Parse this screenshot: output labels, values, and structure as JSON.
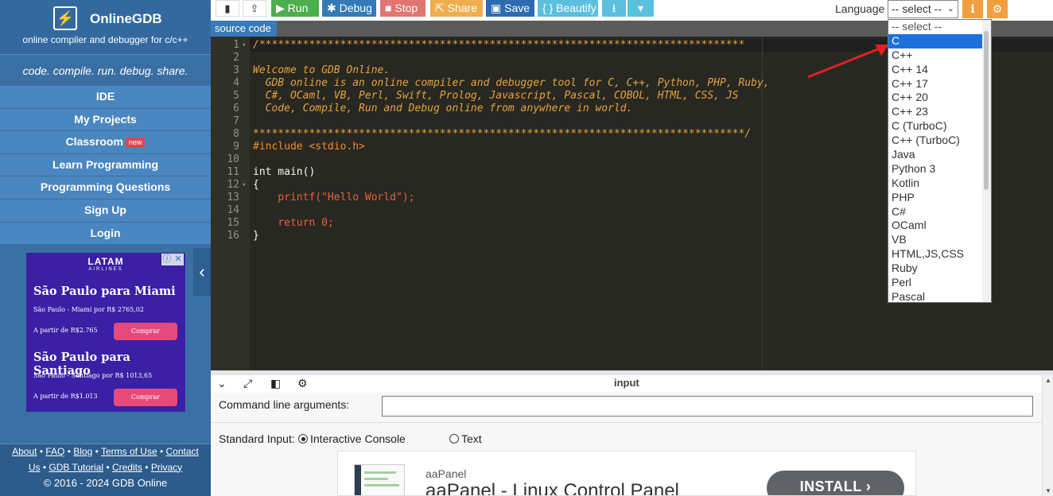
{
  "sidebar": {
    "brand_name": "OnlineGDB",
    "brand_subtitle": "online compiler and debugger for c/c++",
    "tagline": "code. compile. run. debug. share.",
    "nav": [
      "IDE",
      "My Projects",
      "Classroom",
      "Learn Programming",
      "Programming Questions",
      "Sign Up",
      "Login"
    ],
    "classroom_badge": "new",
    "footer": {
      "links_row1": [
        "About",
        "FAQ",
        "Blog",
        "Terms of Use",
        "Contact"
      ],
      "links_row2": [
        "Us",
        "GDB Tutorial",
        "Credits",
        "Privacy"
      ],
      "copyright": "© 2016 - 2024 GDB Online"
    }
  },
  "sidebar_ad": {
    "brand": "LATAM",
    "brand_sub": "AIRLINES",
    "offers": [
      {
        "headline": "São Paulo para Miami",
        "detail": "São Paulo - Miami por R$ 2765,02",
        "price": "A partir de R$2.765",
        "button": "Comprar"
      },
      {
        "headline": "São Paulo para Santiago",
        "detail": "São Paulo - Santiago por R$ 1013,65",
        "price": "A partir de R$1.013",
        "button": "Comprar"
      }
    ],
    "close_glyphs": [
      "ⓘ",
      "✕"
    ]
  },
  "toolbar": {
    "run": "Run",
    "debug": "Debug",
    "stop": "Stop",
    "share": "Share",
    "save": "Save",
    "beautify": "{ } Beautify",
    "language_label": "Language",
    "language_selected": "-- select --",
    "colors": {
      "run": "#4cae4c",
      "debug": "#337ab7",
      "stop": "#d9534f",
      "share": "#f0ad4e",
      "save": "#2b6cb0",
      "beautify": "#5bc0de",
      "download": "#5bc0de"
    }
  },
  "editor": {
    "tab_label": "source code",
    "lines": [
      "/******************************************************************************",
      "",
      "Welcome to GDB Online.",
      "  GDB online is an online compiler and debugger tool for C, C++, Python, PHP, Ruby,",
      "  C#, OCaml, VB, Perl, Swift, Prolog, Javascript, Pascal, COBOL, HTML, CSS, JS",
      "  Code, Compile, Run and Debug online from anywhere in world.",
      "",
      "*******************************************************************************/",
      "#include <stdio.h>",
      "",
      "int main()",
      "{",
      "    printf(\"Hello World\");",
      "",
      "    return 0;",
      "}"
    ]
  },
  "language_dropdown": {
    "options": [
      "-- select --",
      "C",
      "C++",
      "C++ 14",
      "C++ 17",
      "C++ 20",
      "C++ 23",
      "C (TurboC)",
      "C++ (TurboC)",
      "Java",
      "Python 3",
      "Kotlin",
      "PHP",
      "C#",
      "OCaml",
      "VB",
      "HTML,JS,CSS",
      "Ruby",
      "Perl",
      "Pascal"
    ],
    "highlighted": "C"
  },
  "input_panel": {
    "title": "input",
    "cmd_args_label": "Command line arguments:",
    "cmd_args_value": "",
    "stdin_label": "Standard Input:",
    "stdin_options": [
      "Interactive Console",
      "Text"
    ],
    "stdin_selected": "Interactive Console"
  },
  "bottom_ad": {
    "brand": "aaPanel",
    "title": "aaPanel - Linux Control Panel",
    "cta": "INSTALL"
  }
}
